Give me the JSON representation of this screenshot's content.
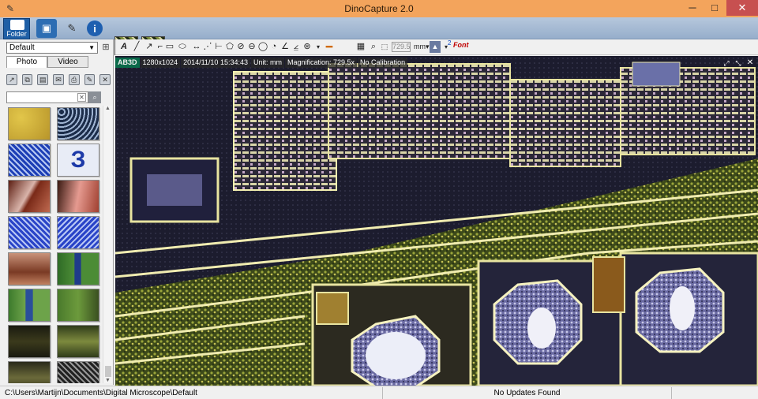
{
  "window": {
    "title": "DinoCapture 2.0",
    "min_glyph": "─",
    "max_glyph": "□",
    "close_glyph": "✕"
  },
  "topband": {
    "folder_label": "Folder"
  },
  "left": {
    "profile_value": "Default",
    "tabs": [
      "Photo",
      "Video"
    ],
    "search_placeholder": ""
  },
  "toolbar": {
    "font_label": "Font",
    "font_size_glyph": "2",
    "zoom_value": "729.5",
    "unit_value": "mm"
  },
  "viewer": {
    "camera_badge": "AB3D",
    "resolution": "1280x1024",
    "timestamp": "2014/11/10 15:34:43",
    "unit": "Unit: mm",
    "magnification": "Magnification: 729.5x",
    "calibration": "No Calibration"
  },
  "statusbar": {
    "path": "C:\\Users\\Martijn\\Documents\\Digital Microscope\\Default",
    "updates": "No Updates Found"
  },
  "colors": {
    "titlebar": "#f3a45c",
    "close": "#c75050",
    "accent": "#1f5fa6"
  }
}
